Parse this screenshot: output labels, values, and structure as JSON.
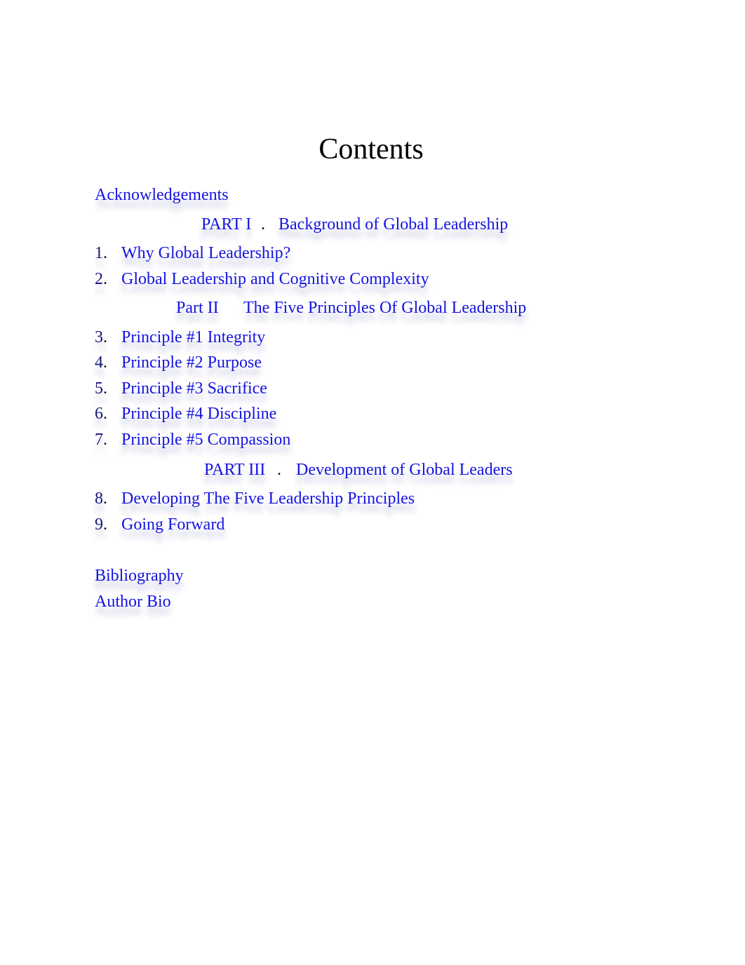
{
  "page": {
    "title": "Contents"
  },
  "front_matter": [
    {
      "label": "Acknowledgements"
    }
  ],
  "parts": [
    {
      "label": "PART I",
      "separator": ".",
      "title": "Background of Global Leadership"
    },
    {
      "label": "Part II",
      "separator": "",
      "title": "The Five Principles Of Global Leadership"
    },
    {
      "label": "PART III",
      "separator": ".",
      "title": "Development of Global Leaders"
    }
  ],
  "chapters": [
    {
      "number": "1",
      "title": "Why Global Leadership?"
    },
    {
      "number": "2",
      "title": "Global Leadership and Cognitive Complexity"
    },
    {
      "number": "3",
      "title": "Principle #1 Integrity"
    },
    {
      "number": "4",
      "title": "Principle #2 Purpose"
    },
    {
      "number": "5",
      "title": "Principle #3 Sacrifice"
    },
    {
      "number": "6",
      "title": "Principle #4 Discipline"
    },
    {
      "number": "7",
      "title": "Principle #5 Compassion"
    },
    {
      "number": "8",
      "title": "Developing The Five Leadership Principles"
    },
    {
      "number": "9",
      "title": "Going Forward"
    }
  ],
  "back_matter": [
    {
      "label": "Bibliography"
    },
    {
      "label": "Author Bio"
    }
  ],
  "colors": {
    "link": "#1414e0",
    "number": "#14147a",
    "title": "#000000"
  }
}
